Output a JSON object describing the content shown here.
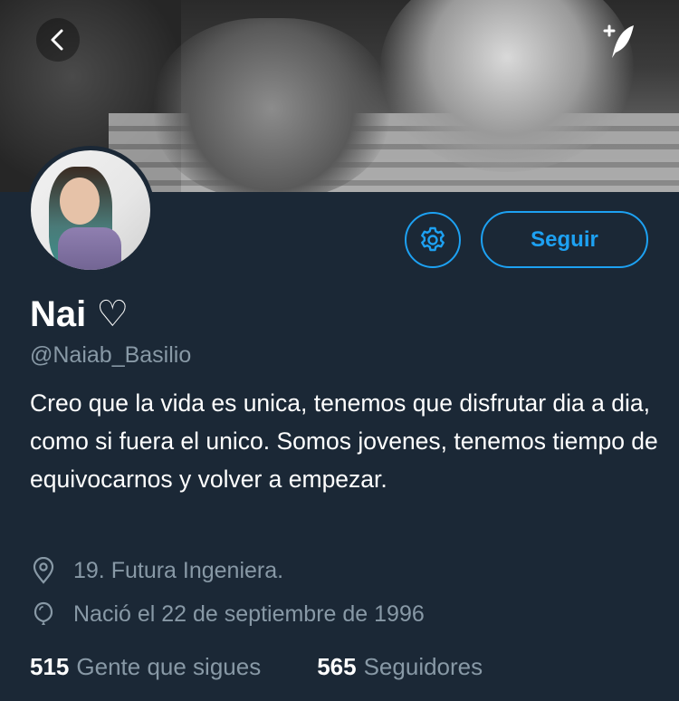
{
  "header": {
    "back_icon": "chevron-left-icon",
    "compose_icon": "compose-tweet-icon"
  },
  "profile": {
    "name": "Nai",
    "name_symbol": "♡",
    "handle": "@Naiab_Basilio",
    "bio": "Creo que la vida es unica, tenemos que disfrutar dia a dia, como si fuera el unico. Somos jovenes, tenemos tiempo de equivocarnos y volver a empezar.",
    "location": "19. Futura Ingeniera.",
    "birthdate": "Nació el 22 de septiembre de 1996"
  },
  "actions": {
    "settings_icon": "gear-icon",
    "follow_label": "Seguir"
  },
  "stats": {
    "following_count": "515",
    "following_label": "Gente que sigues",
    "followers_count": "565",
    "followers_label": "Seguidores"
  },
  "colors": {
    "background": "#1b2836",
    "accent": "#1da1f2",
    "secondary_text": "#8899a6"
  }
}
